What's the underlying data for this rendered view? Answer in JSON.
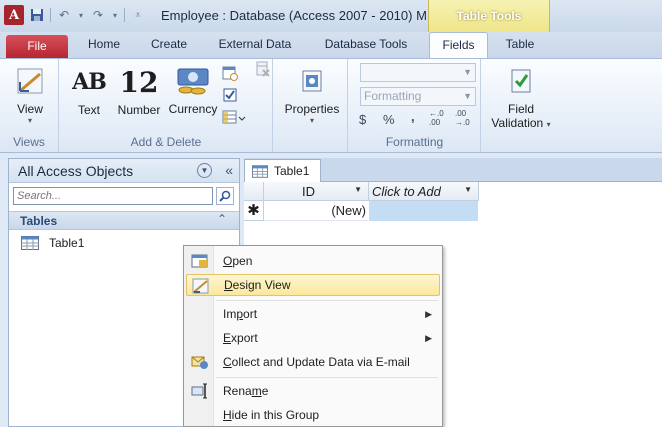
{
  "window": {
    "app_icon_letter": "A",
    "title": "Employee : Database (Access 2007 - 2010) M",
    "context_group": "Table Tools"
  },
  "tabs": [
    {
      "label": "File"
    },
    {
      "label": "Home"
    },
    {
      "label": "Create"
    },
    {
      "label": "External Data"
    },
    {
      "label": "Database Tools"
    },
    {
      "label": "Fields"
    },
    {
      "label": "Table"
    }
  ],
  "ribbon": {
    "views": {
      "view_label": "View",
      "group_label": "Views"
    },
    "add_delete": {
      "text_label": "Text",
      "text_glyph": "AB",
      "number_label": "Number",
      "number_glyph": "12",
      "currency_label": "Currency",
      "group_label": "Add & Delete"
    },
    "properties": {
      "label": "Properties"
    },
    "formatting": {
      "format_value": "",
      "format_placeholder": "Formatting",
      "currency_symbol": "$",
      "percent_symbol": "%",
      "comma_symbol": ",",
      "inc_decimal": "←.0 .00",
      "dec_decimal": ".00 →.0",
      "group_label": "Formatting"
    },
    "field_validation": {
      "label_line1": "Field",
      "label_line2": "Validation"
    }
  },
  "nav_pane": {
    "title": "All Access Objects",
    "search_placeholder": "Search...",
    "section": "Tables",
    "items": [
      {
        "label": "Table1"
      }
    ]
  },
  "document": {
    "tab_label": "Table1",
    "columns": [
      {
        "label": "ID"
      },
      {
        "label": "Click to Add"
      }
    ],
    "new_row_marker": "✱",
    "new_row_value": "(New)"
  },
  "context_menu": {
    "items": [
      {
        "pre": "",
        "key": "O",
        "post": "pen"
      },
      {
        "pre": "",
        "key": "D",
        "post": "esign View"
      },
      {
        "pre": "Im",
        "key": "p",
        "post": "ort"
      },
      {
        "pre": "",
        "key": "E",
        "post": "xport"
      },
      {
        "pre": "",
        "key": "C",
        "post": "ollect and Update Data via E-mail"
      },
      {
        "pre": "Rena",
        "key": "m",
        "post": "e"
      },
      {
        "pre": "",
        "key": "H",
        "post": "ide in this Group"
      }
    ]
  },
  "colors": {
    "file_tab": "#c0303b",
    "context_tab": "#efe58a",
    "highlight": "#fbe89a",
    "selected_cell": "#c5dcf5"
  }
}
